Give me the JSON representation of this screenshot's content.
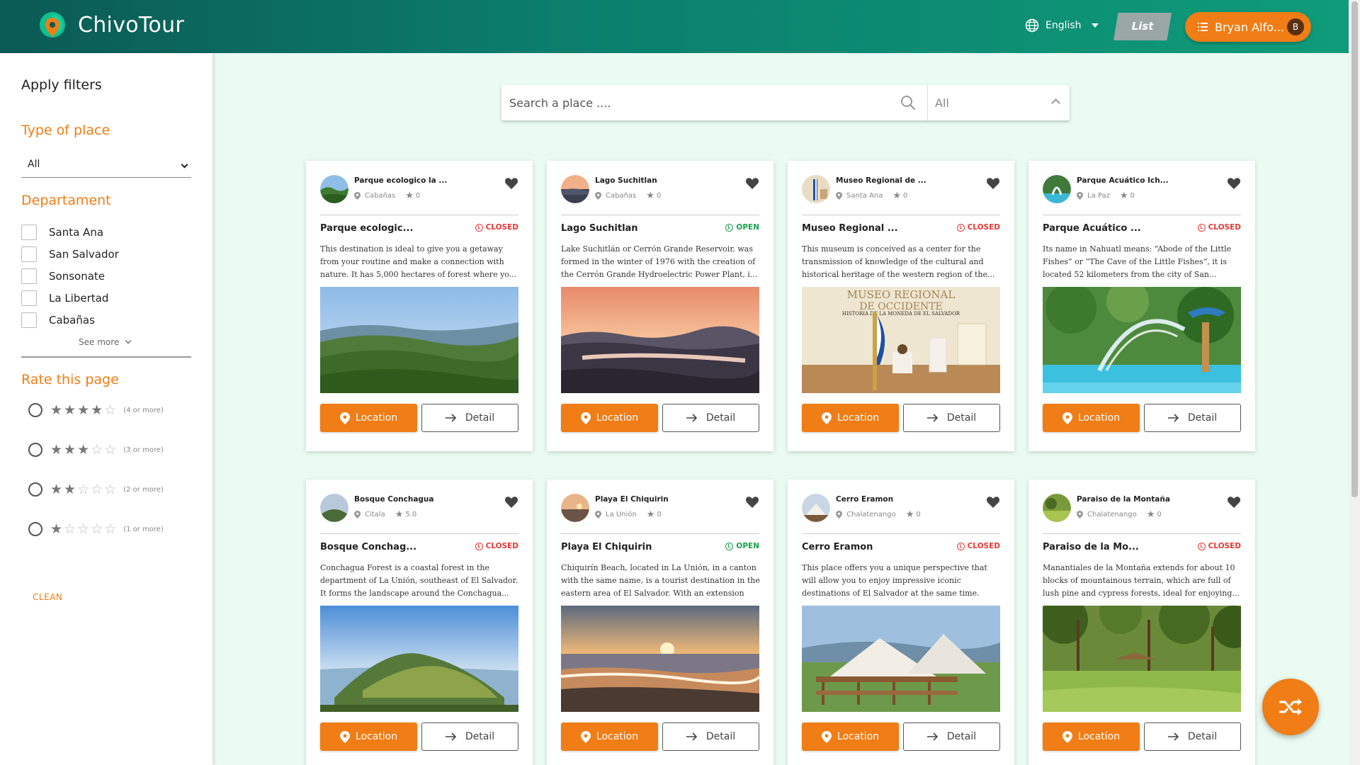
{
  "header": {
    "brand": "ChivoTour",
    "language": "English",
    "list_label": "List",
    "user_name": "Bryan Alfo...",
    "user_initial": "B"
  },
  "sidebar": {
    "title": "Apply filters",
    "type_section": "Type of place",
    "type_value": "All",
    "department_section": "Departament",
    "departments": [
      "Santa Ana",
      "San Salvador",
      "Sonsonate",
      "La Libertad",
      "Cabañas"
    ],
    "see_more": "See more",
    "rate_section": "Rate this page",
    "ratings": [
      {
        "stars": 4,
        "label": "(4 or more)"
      },
      {
        "stars": 3,
        "label": "(3 or more)"
      },
      {
        "stars": 2,
        "label": "(2 or more)"
      },
      {
        "stars": 1,
        "label": "(1 or more)"
      }
    ],
    "clean": "CLEAN"
  },
  "search": {
    "placeholder": "Search a place ....",
    "category": "All"
  },
  "colors": {
    "accent": "#f07d15",
    "open": "#16a34a",
    "closed": "#e53935",
    "header_start": "#0b5a55",
    "header_end": "#0e9c7a"
  },
  "places": [
    {
      "name": "Parque ecologico la ...",
      "dept": "Cabañas",
      "rating": "0",
      "title": "Parque ecologic...",
      "status": "CLOSED",
      "desc": "This destination is ideal to give you a getaway from your routine and make a connection with nature. It has 5,000 hectares of forest where yo..."
    },
    {
      "name": "Lago Suchitlan",
      "dept": "Cabañas",
      "rating": "0",
      "title": "Lago Suchitlan",
      "status": "OPEN",
      "desc": "Lake Suchitlán or Cerrón Grande Reservoir, was formed in the winter of 1976 with the creation of the Cerrón Grande Hydroelectric Power Plant, i..."
    },
    {
      "name": "Museo Regional de ...",
      "dept": "Santa Ana",
      "rating": "0",
      "title": "Museo Regional ...",
      "status": "CLOSED",
      "desc": "This museum is conceived as a center for the transmission of knowledge of the cultural and historical heritage of the western region of the..."
    },
    {
      "name": "Parque Acuático Ich...",
      "dept": "La Paz",
      "rating": "0",
      "title": "Parque Acuático ...",
      "status": "CLOSED",
      "desc": "Its name in Nahuatl means: “Abode of the Little Fishes” or “The Cave of the Little Fishes”, it is located 52 kilometers from the city of San..."
    },
    {
      "name": "Bosque Conchagua",
      "dept": "Citala",
      "rating": "5.0",
      "title": "Bosque Conchag...",
      "status": "CLOSED",
      "desc": "Conchagua Forest is a coastal forest in the department of La Unión, southeast of El Salvador. It forms the landscape around the Conchagua..."
    },
    {
      "name": "Playa El Chiquirin",
      "dept": "La Unión",
      "rating": "0",
      "title": "Playa El Chiquirin",
      "status": "OPEN",
      "desc": "Chiquirín Beach, located in La Unión, in a canton with the same name, is a tourist destination in the eastern area of El Salvador. With an extension of..."
    },
    {
      "name": "Cerro Eramon",
      "dept": "Chalatenango",
      "rating": "0",
      "title": "Cerro Eramon",
      "status": "CLOSED",
      "desc": "This place offers you a unique perspective that will allow you to enjoy impressive iconic destinations of El Salvador at the same time. Fro..."
    },
    {
      "name": "Paraiso de la Montaña",
      "dept": "Chalatenango",
      "rating": "0",
      "title": "Paraiso de la Mo...",
      "status": "CLOSED",
      "desc": "Manantiales de la Montaña extends for about 10 blocks of mountainous terrain, which are full of lush pine and cypress forests, ideal for enjoying..."
    }
  ],
  "card_actions": {
    "location": "Location",
    "detail": "Detail"
  },
  "museum_sign": {
    "line1": "MUSEO REGIONAL",
    "line2": "DE OCCIDENTE",
    "line3": "HISTORIA DE LA MONEDA DE EL SALVADOR"
  },
  "icons": {
    "logo": "map-pin-logo-icon",
    "language": "globe-icon",
    "user_menu": "menu-lines-icon",
    "search": "search-icon",
    "favorite": "heart-icon",
    "location": "map-pin-icon",
    "detail": "arrow-right-icon",
    "status": "clock-icon",
    "shuffle": "shuffle-icon"
  }
}
